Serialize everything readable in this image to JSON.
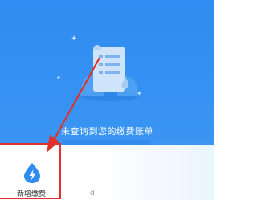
{
  "empty_state": {
    "message": "未查询到您的缴费账单"
  },
  "quick_actions": [
    {
      "label": "新增缴费",
      "icon": "lightning-drop-icon"
    }
  ],
  "next_item_label": "d",
  "colors": {
    "header_blue": "#2f8cf0",
    "annotation_red": "#e0322a",
    "icon_blue": "#2f8cf0"
  }
}
